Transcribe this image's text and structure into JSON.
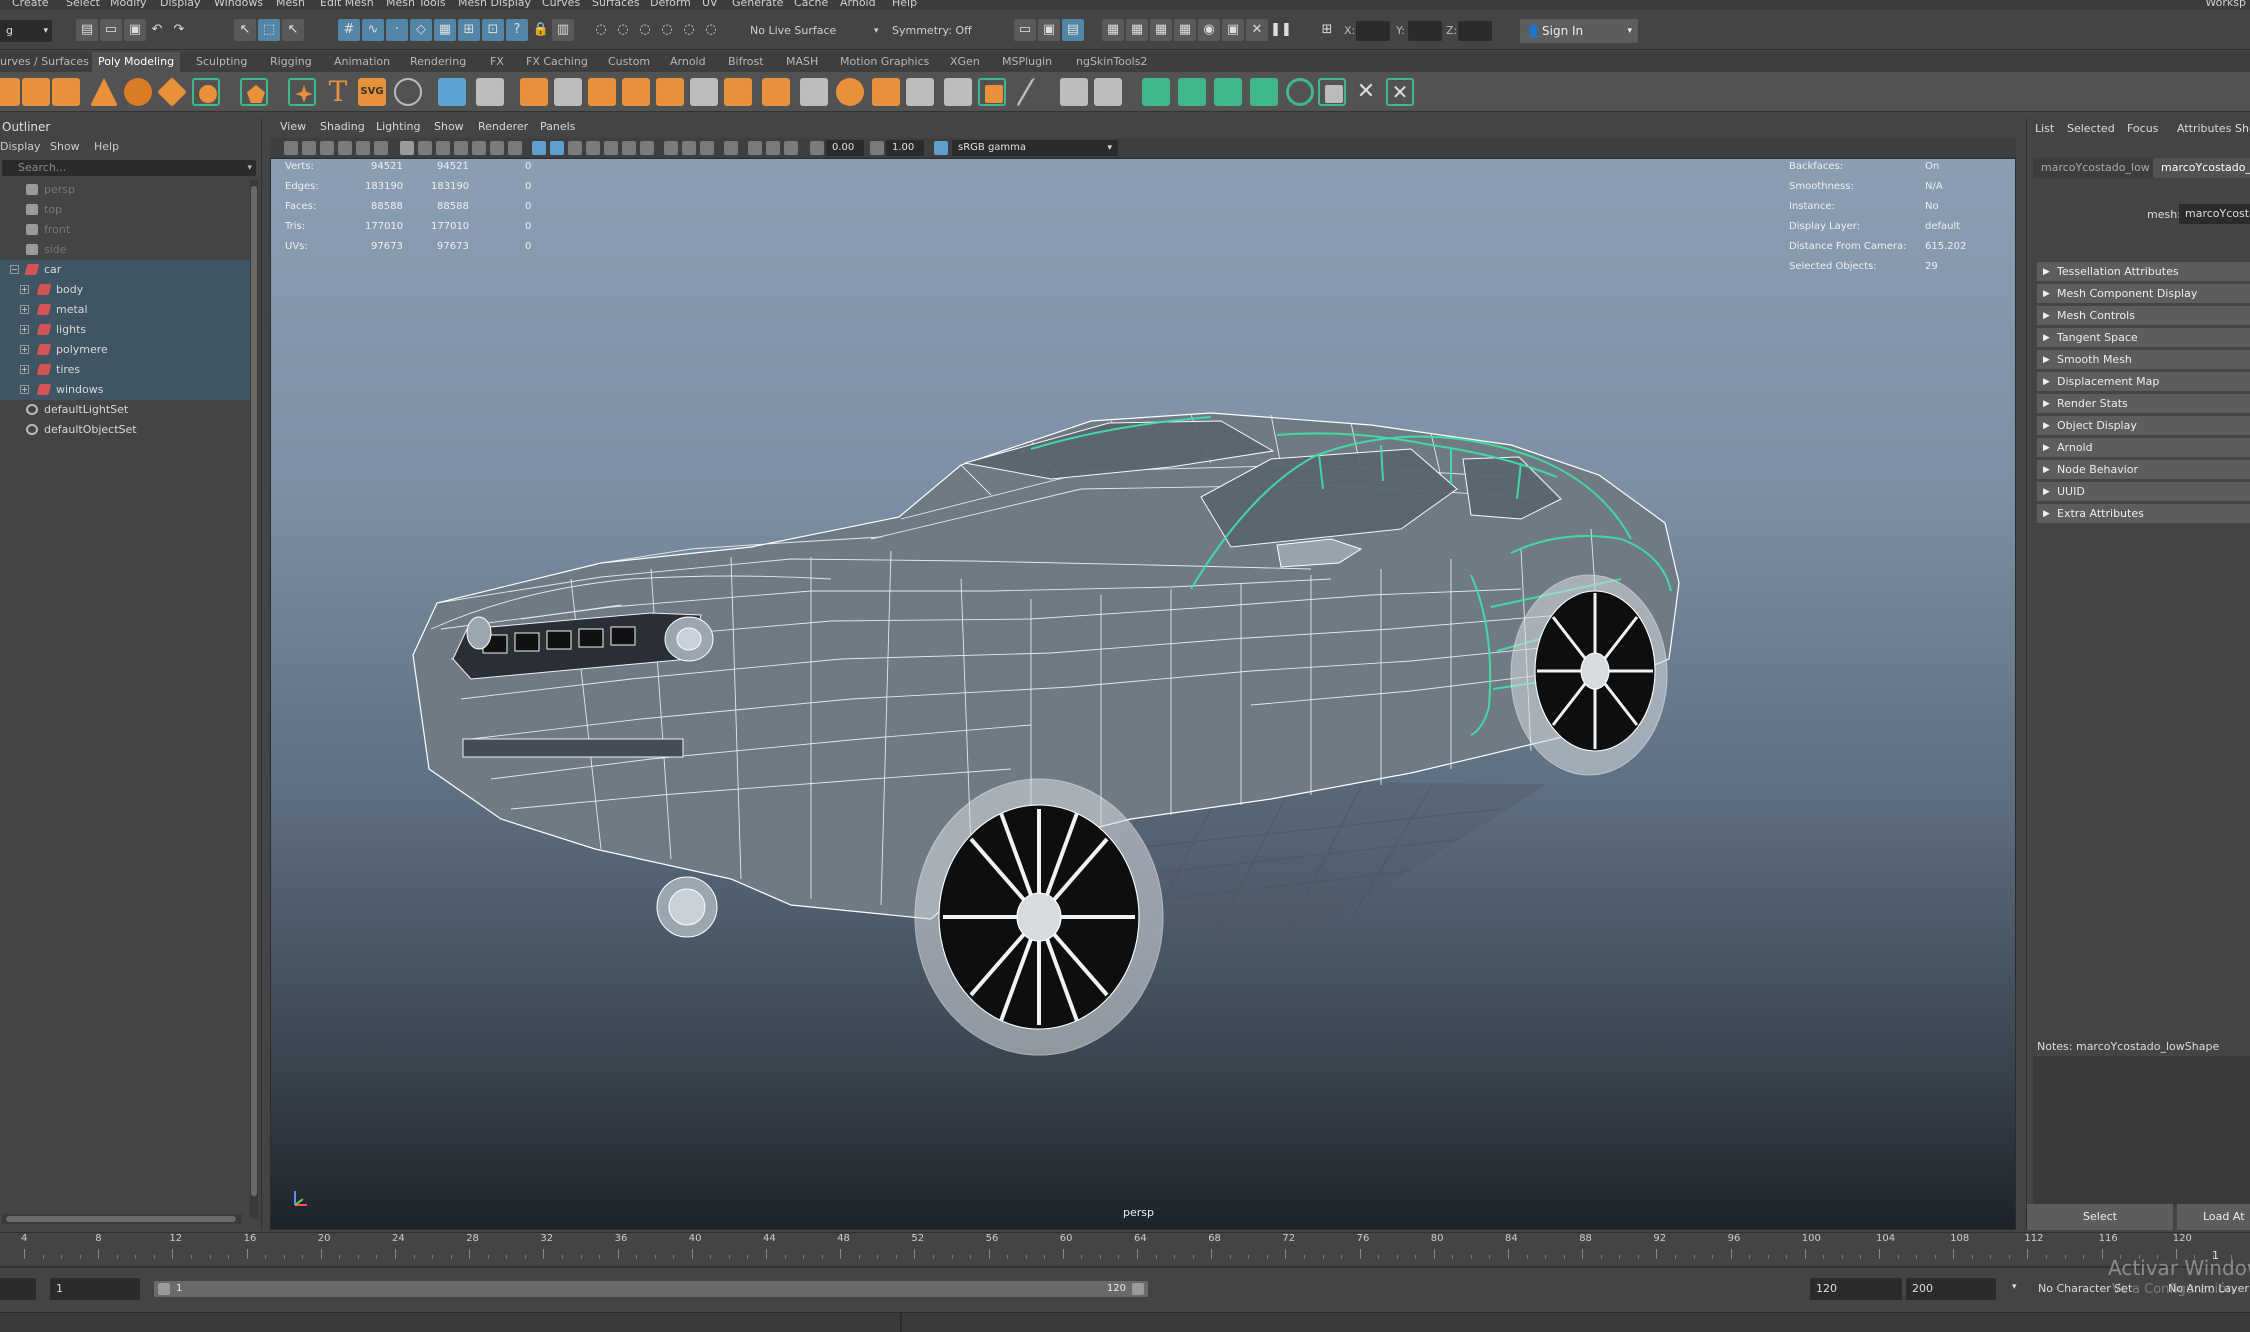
{
  "menubar": {
    "items": [
      "Create",
      "Select",
      "Modify",
      "Display",
      "Windows",
      "Mesh",
      "Edit Mesh",
      "Mesh Tools",
      "Mesh Display",
      "Curves",
      "Surfaces",
      "Deform",
      "UV",
      "Generate",
      "Cache",
      "Arnold",
      "Help"
    ],
    "workspace": "Worksp"
  },
  "statusline": {
    "mode_value": "g",
    "live_surface": "No Live Surface",
    "symmetry": "Symmetry: Off",
    "axis_x": "X:",
    "axis_y": "Y:",
    "axis_z": "Z:",
    "sign_in": "Sign In"
  },
  "shelf_tabs": [
    "urves / Surfaces",
    "Poly Modeling",
    "Sculpting",
    "Rigging",
    "Animation",
    "Rendering",
    "FX",
    "FX Caching",
    "Custom",
    "Arnold",
    "Bifrost",
    "MASH",
    "Motion Graphics",
    "XGen",
    "MSPlugin",
    "ngSkinTools2"
  ],
  "shelf_active_tab": "Poly Modeling",
  "shelf_icons": {
    "text_icon": "T",
    "svg_icon": "SVG"
  },
  "outliner": {
    "title": "Outliner",
    "menu": [
      "Display",
      "Show",
      "Help"
    ],
    "search_placeholder": "Search...",
    "items": [
      {
        "label": "persp",
        "type": "camera",
        "dim": true
      },
      {
        "label": "top",
        "type": "camera",
        "dim": true
      },
      {
        "label": "front",
        "type": "camera",
        "dim": true
      },
      {
        "label": "side",
        "type": "camera",
        "dim": true
      },
      {
        "label": "car",
        "type": "group",
        "selected": true
      },
      {
        "label": "body",
        "type": "group",
        "selected": true
      },
      {
        "label": "metal",
        "type": "group",
        "selected": true
      },
      {
        "label": "lights",
        "type": "group",
        "selected": true
      },
      {
        "label": "polymere",
        "type": "group",
        "selected": true
      },
      {
        "label": "tires",
        "type": "group",
        "selected": true
      },
      {
        "label": "windows",
        "type": "group",
        "selected": true
      },
      {
        "label": "defaultLightSet",
        "type": "set"
      },
      {
        "label": "defaultObjectSet",
        "type": "set"
      }
    ]
  },
  "viewport": {
    "menu": [
      "View",
      "Shading",
      "Lighting",
      "Show",
      "Renderer",
      "Panels"
    ],
    "near_value": "0.00",
    "far_value": "1.00",
    "color_space": "sRGB gamma",
    "camera_label": "persp",
    "hud_left": [
      {
        "label": "Verts:",
        "v1": "94521",
        "v2": "94521",
        "v3": "0"
      },
      {
        "label": "Edges:",
        "v1": "183190",
        "v2": "183190",
        "v3": "0"
      },
      {
        "label": "Faces:",
        "v1": "88588",
        "v2": "88588",
        "v3": "0"
      },
      {
        "label": "Tris:",
        "v1": "177010",
        "v2": "177010",
        "v3": "0"
      },
      {
        "label": "UVs:",
        "v1": "97673",
        "v2": "97673",
        "v3": "0"
      }
    ],
    "hud_right": [
      {
        "label": "Backfaces:",
        "value": "On"
      },
      {
        "label": "Smoothness:",
        "value": "N/A"
      },
      {
        "label": "Instance:",
        "value": "No"
      },
      {
        "label": "Display Layer:",
        "value": "default"
      },
      {
        "label": "Distance From Camera:",
        "value": "615.202"
      },
      {
        "label": "Selected Objects:",
        "value": "29"
      }
    ]
  },
  "attribute_editor": {
    "menu": [
      "List",
      "Selected",
      "Focus",
      "Attributes",
      "Sho"
    ],
    "tabs": [
      "marcoYcostado_low",
      "marcoYcostado_l"
    ],
    "mesh_label": "mesh:",
    "mesh_value": "marcoYcostado",
    "sections": [
      "Tessellation Attributes",
      "Mesh Component Display",
      "Mesh Controls",
      "Tangent Space",
      "Smooth Mesh",
      "Displacement Map",
      "Render Stats",
      "Object Display",
      "Arnold",
      "Node Behavior",
      "UUID",
      "Extra Attributes"
    ],
    "notes_label": "Notes:  marcoYcostado_lowShape",
    "select_button": "Select",
    "load_button": "Load At"
  },
  "timeslider": {
    "ticks": [
      "4",
      "8",
      "12",
      "16",
      "20",
      "24",
      "28",
      "32",
      "36",
      "40",
      "44",
      "48",
      "52",
      "56",
      "60",
      "64",
      "68",
      "72",
      "76",
      "80",
      "84",
      "88",
      "92",
      "96",
      "100",
      "104",
      "108",
      "112",
      "116",
      "120"
    ],
    "current_frame": "1"
  },
  "rangeslider": {
    "start_field": "1",
    "range_start": "1",
    "range_end": "120",
    "end_field": "120",
    "anim_end_field": "200",
    "character_set": "No Character Set",
    "anim_layer": "No Anim Layer"
  },
  "watermark": {
    "line1": "Activar Windows",
    "line2": "Ve a Configuración"
  },
  "colors": {
    "accent_blue": "#5285a6",
    "selection_green": "#3fe4a8",
    "shelf_orange": "#e8913a",
    "outliner_selected": "#3f5563"
  }
}
